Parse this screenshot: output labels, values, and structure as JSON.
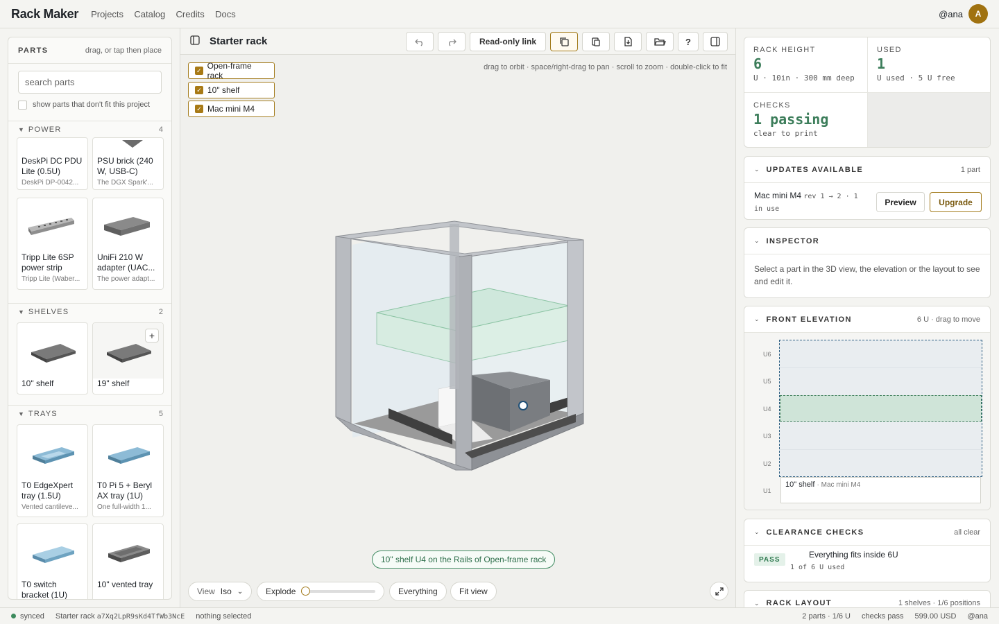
{
  "app": {
    "brand": "Rack Maker",
    "nav": [
      "Projects",
      "Catalog",
      "Credits",
      "Docs"
    ],
    "user": "@ana",
    "avatar_letter": "A"
  },
  "parts": {
    "title": "PARTS",
    "subtitle": "drag, or tap then place",
    "search_placeholder": "search parts",
    "show_unfit_label": "show parts that don't fit this project",
    "sections": {
      "power": {
        "name": "POWER",
        "count": "4",
        "items": [
          {
            "title": "DeskPi DC PDU Lite (0.5U)",
            "sub": "DeskPi DP-0042..."
          },
          {
            "title": "PSU brick (240 W, USB-C)",
            "sub": "The DGX Spark'..."
          },
          {
            "title": "Tripp Lite 6SP power strip",
            "sub": "Tripp Lite (Waber..."
          },
          {
            "title": "UniFi 210 W adapter (UAC...",
            "sub": "The power adapt..."
          }
        ]
      },
      "shelves": {
        "name": "SHELVES",
        "count": "2",
        "items": [
          {
            "title": "10\" shelf"
          },
          {
            "title": "19\" shelf"
          }
        ]
      },
      "trays": {
        "name": "TRAYS",
        "count": "5",
        "items": [
          {
            "title": "T0 EdgeXpert tray (1.5U)",
            "sub": "Vented cantileve..."
          },
          {
            "title": "T0 Pi 5 + Beryl AX tray (1U)",
            "sub": "One full-width 1..."
          },
          {
            "title": "T0 switch bracket (1U)"
          },
          {
            "title": "10\" vented tray"
          }
        ]
      }
    },
    "plus_label": "+"
  },
  "viewport": {
    "title": "Starter rack",
    "readonly_link": "Read-only link",
    "help_label": "?",
    "layers": [
      "Open-frame rack",
      "10\" shelf",
      "Mac mini M4"
    ],
    "hint": "drag to orbit · space/right-drag to pan · scroll to zoom · double-click to fit",
    "status": "10\" shelf U4 on the Rails of Open-frame rack",
    "view_label": "View",
    "view_value": "Iso",
    "explode_label": "Explode",
    "explode_value": 0,
    "everything_label": "Everything",
    "fit_view_label": "Fit view"
  },
  "stats": {
    "rack_height": {
      "label": "RACK HEIGHT",
      "value": "6",
      "detail": "U · 10in · 300 mm deep"
    },
    "used": {
      "label": "USED",
      "value": "1",
      "detail": "U used · 5 U free"
    },
    "checks": {
      "label": "CHECKS",
      "value": "1 passing",
      "detail": "clear to print"
    }
  },
  "updates": {
    "title": "UPDATES AVAILABLE",
    "right": "1 part",
    "item_name": "Mac mini M4",
    "item_rev": "rev 1 → 2 · 1",
    "item_use": "in use",
    "preview": "Preview",
    "upgrade": "Upgrade"
  },
  "inspector": {
    "title": "INSPECTOR",
    "text": "Select a part in the 3D view, the elevation or the layout to see and edit it."
  },
  "elevation": {
    "title": "FRONT ELEVATION",
    "right": "6 U · drag to move",
    "units": [
      "U6",
      "U5",
      "U4",
      "U3",
      "U2",
      "U1"
    ],
    "slot_shelf": "10\" shelf",
    "slot_device": "· Mac mini M4"
  },
  "clearance": {
    "title": "CLEARANCE CHECKS",
    "right": "all clear",
    "badge": "PASS",
    "text": "Everything fits inside 6U",
    "detail": "1 of 6 U used"
  },
  "layout": {
    "title": "RACK LAYOUT",
    "right": "1 shelves · 1/6 positions"
  },
  "footer": {
    "sync": "synced",
    "project": "Starter rack",
    "hash": "a7Xq2LpR9sKd4TfWb3NcE",
    "selection": "nothing selected",
    "parts": "2 parts · 1/6 U",
    "checks": "checks pass",
    "price": "599.00 USD",
    "user": "@ana"
  },
  "colors": {
    "accent": "#a27a1a",
    "pass_green": "#3c7d5a",
    "avatar": "#a07210"
  }
}
